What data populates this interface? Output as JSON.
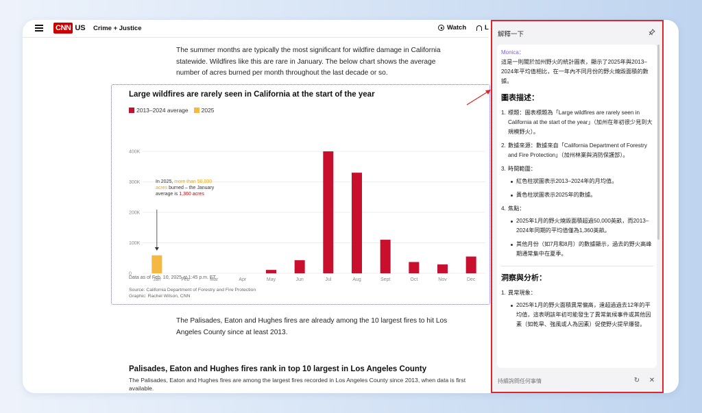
{
  "header": {
    "logo": "CNN",
    "edition": "US",
    "section": "Crime + Justice",
    "watch_label": "Watch",
    "listen_label": "L"
  },
  "article": {
    "intro": "The summer months are typically the most significant for wildfire damage in California statewide. Wildfires like this are rare in January. The below chart shows the average number of acres burned per month throughout the last decade or so.",
    "after_chart": "The Palisades, Eaton and Hughes fires are already among the 10 largest fires to hit Los Angeles County since at least 2013.",
    "next_heading": "Palisades, Eaton and Hughes fires rank in top 10 largest in Los Angeles County",
    "next_text": "The Palisades, Eaton and Hughes fires are among the largest fires recorded in Los Angeles County since 2013, when data is first available."
  },
  "chart": {
    "note_prefix": "In 2025, ",
    "note_highlight": "more than 50,000 acres",
    "note_middle": " burned – the January average is ",
    "note_red": "1,360 acres",
    "as_of": "Data as of Feb. 10, 2025 at 1:45 p.m. ET",
    "source": "Source: California Department of Forestry and Fire Protection",
    "graphic": "Graphic: Rachel Wilson, CNN"
  },
  "chart_data": {
    "type": "bar",
    "title": "Large wildfires are rarely seen in California at the start of the year",
    "categories": [
      "Jan",
      "Feb",
      "Mar",
      "Apr",
      "May",
      "Jun",
      "Jul",
      "Aug",
      "Sept",
      "Oct",
      "Nov",
      "Dec"
    ],
    "series": [
      {
        "name": "2013–2024 average",
        "color": "#c8102e",
        "values": [
          1360,
          0,
          0,
          0,
          11000,
          43000,
          400000,
          330000,
          110000,
          37000,
          29000,
          55000
        ]
      },
      {
        "name": "2025",
        "color": "#f5b942",
        "values": [
          59000,
          null,
          null,
          null,
          null,
          null,
          null,
          null,
          null,
          null,
          null,
          null
        ]
      }
    ],
    "ylim": [
      0,
      400000
    ],
    "yticks": [
      "0",
      "100K",
      "200K",
      "300K",
      "400K"
    ],
    "grid": true,
    "legend_position": "top-left"
  },
  "panel": {
    "title": "解釋一下",
    "author": "Monica：",
    "intro": "這是一則關於加州野火的統計圖表，顯示了2025年與2013–2024年平均值相比，在一年內不同月份的野火燒毀面積的數據。",
    "section1_title": "圖表描述：",
    "items": [
      {
        "num": "1.",
        "text": "標題：圖表標題為「Large wildfires are rarely seen in California at the start of the year」（加州在年初很少見到大規模野火）。"
      },
      {
        "num": "2.",
        "text": "數據來源：數據來自「California Department of Forestry and Fire Protection」（加州林業與消防保護部）。"
      }
    ],
    "item3_title": "時間範圍：",
    "item3_bullets": [
      "紅色柱狀圖表示2013–2024年的月均值。",
      "黃色柱狀圖表示2025年的數據。"
    ],
    "item4_title": "焦點：",
    "item4_bullets": [
      "2025年1月的野火燒毀面積超過50,000英畝，而2013–2024年同期的平均值僅為1,360英畝。",
      "其他月份（如7月和8月）的數據顯示，過去的野火高峰期通常集中在夏季。"
    ],
    "section2_title": "洞察與分析：",
    "item5_title": "異常現象：",
    "item5_bullets": [
      "2025年1月的野火面積異常偏高，遠超過過去12年的平均值，這表明該年初可能發生了異常氣候事件或其他因素（如乾旱、強風或人為因素）促使野火提早爆發。"
    ],
    "input_placeholder": "持續詢問任何事情"
  }
}
